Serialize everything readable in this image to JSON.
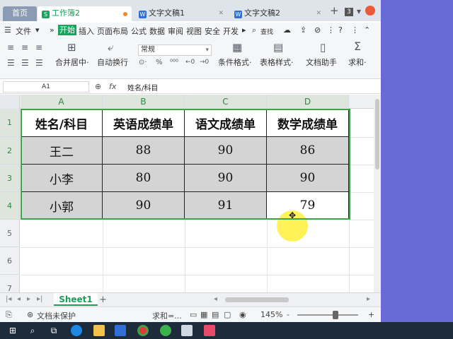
{
  "tabs": {
    "home": "首页",
    "workbook": "工作簿2",
    "doc1": "文字文稿1",
    "doc2": "文字文稿2",
    "plus": "+",
    "count": "3"
  },
  "menu": {
    "file": "文件",
    "items": [
      "开始",
      "插入",
      "页面布局",
      "公式",
      "数据",
      "审阅",
      "视图",
      "安全",
      "开发"
    ],
    "search": "查找",
    "help": "?"
  },
  "ribbon": {
    "merge": "合并居中·",
    "wrap": "自动换行",
    "number_format": "常规",
    "conditional": "条件格式·",
    "table_style": "表格样式·",
    "doc_helper": "文档助手",
    "sum": "求和·"
  },
  "formula_bar": {
    "cell_ref": "A1",
    "fx": "fx",
    "content": "姓名/科目"
  },
  "columns": [
    "A",
    "B",
    "C",
    "D"
  ],
  "rows": [
    "1",
    "2",
    "3",
    "4",
    "5",
    "6",
    "7"
  ],
  "table": {
    "header": [
      "姓名/科目",
      "英语成绩单",
      "语文成绩单",
      "数学成绩单"
    ],
    "body": [
      [
        "王二",
        "88",
        "90",
        "86"
      ],
      [
        "小李",
        "80",
        "90",
        "90"
      ],
      [
        "小郭",
        "90",
        "91",
        "79"
      ]
    ]
  },
  "sheets": {
    "active": "Sheet1",
    "add": "+"
  },
  "status": {
    "protect": "文档未保护",
    "sum": "求和=...",
    "zoom": "145%",
    "zoom_minus": "-",
    "zoom_plus": "+"
  },
  "colors": {
    "accent": "#1aa35c",
    "selection": "#3aa548",
    "data_fill": "#d4d4d4",
    "desktop": "#6a6ad6"
  }
}
